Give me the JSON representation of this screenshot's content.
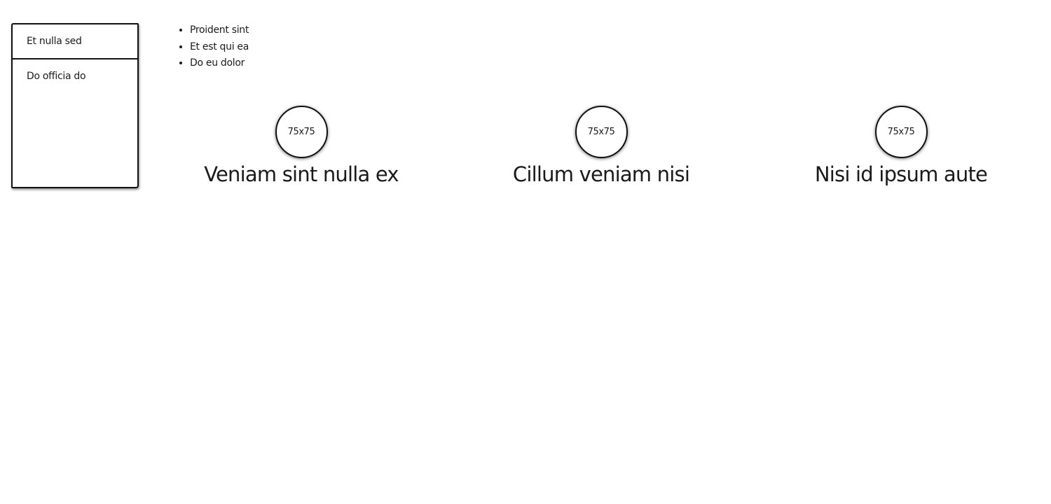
{
  "sidebar": {
    "items": [
      {
        "label": "Et nulla sed"
      },
      {
        "label": "Do officia do"
      }
    ]
  },
  "list": {
    "items": [
      "Proident sint",
      "Et est qui ea",
      "Do eu dolor"
    ]
  },
  "features": [
    {
      "image_label": "75x75",
      "title": "Veniam sint nulla ex"
    },
    {
      "image_label": "75x75",
      "title": "Cillum veniam nisi"
    },
    {
      "image_label": "75x75",
      "title": "Nisi id ipsum aute"
    }
  ]
}
